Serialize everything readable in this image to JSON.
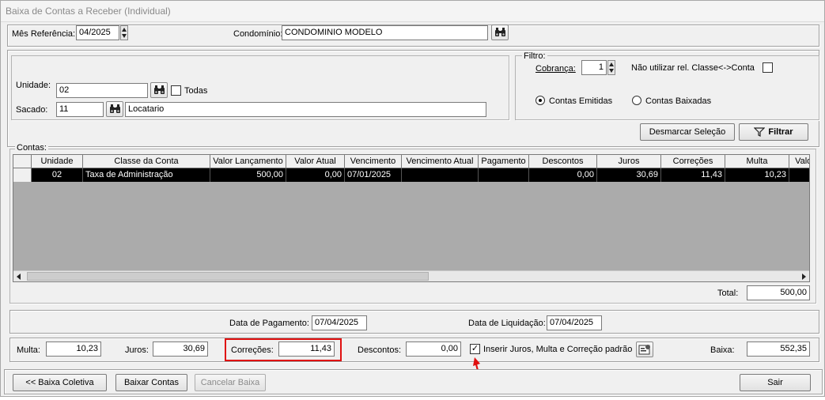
{
  "window": {
    "title": "Baixa de Contas a Receber (Individual)"
  },
  "header": {
    "mes_referencia_label": "Mês Referência:",
    "mes_referencia_value": "04/2025",
    "condominio_label": "Condomínio:",
    "condominio_value": "CONDOMINIO MODELO"
  },
  "selection": {
    "unidade_label": "Unidade:",
    "unidade_value": "02",
    "todas_label": "Todas",
    "sacado_label": "Sacado:",
    "sacado_code": "11",
    "sacado_name": "Locatario"
  },
  "filtro": {
    "legend": "Filtro:",
    "cobranca_label": "Cobrança:",
    "cobranca_value": "1",
    "nao_utilizar_label": "Não utilizar rel. Classe<->Conta",
    "radio_emitidas": "Contas Emitidas",
    "radio_baixadas": "Contas Baixadas"
  },
  "actions": {
    "desmarcar_selecao": "Desmarcar Seleção",
    "filtrar": "Filtrar"
  },
  "contas": {
    "legend": "Contas:",
    "columns": [
      "Unidade",
      "Classe da Conta",
      "Valor Lançamento",
      "Valor Atual",
      "Vencimento",
      "Vencimento Atual",
      "Pagamento",
      "Descontos",
      "Juros",
      "Correções",
      "Multa",
      "Valor"
    ],
    "rows": [
      [
        "02",
        "Taxa de Administração",
        "500,00",
        "0,00",
        "07/01/2025",
        "",
        "",
        "0,00",
        "30,69",
        "11,43",
        "10,23",
        ""
      ]
    ],
    "total_label": "Total:",
    "total_value": "500,00"
  },
  "dates": {
    "pagamento_label": "Data de Pagamento:",
    "pagamento_value": "07/04/2025",
    "liquidacao_label": "Data de Liquidação:",
    "liquidacao_value": "07/04/2025"
  },
  "values": {
    "multa_label": "Multa:",
    "multa_value": "10,23",
    "juros_label": "Juros:",
    "juros_value": "30,69",
    "correcoes_label": "Correções:",
    "correcoes_value": "11,43",
    "descontos_label": "Descontos:",
    "descontos_value": "0,00",
    "inserir_label": "Inserir Juros, Multa e Correção padrão",
    "baixa_label": "Baixa:",
    "baixa_value": "552,35"
  },
  "footer": {
    "baixa_coletiva": "<< Baixa Coletiva",
    "baixar_contas": "Baixar Contas",
    "cancelar_baixa": "Cancelar Baixa",
    "sair": "Sair"
  },
  "colors": {
    "annotation": "#e01010",
    "selected_row": "#000000"
  },
  "icons": {
    "search": "binoculars-icon",
    "filter": "funnel-icon",
    "settings": "settings-icon",
    "arrow": "red-arrow-icon"
  }
}
